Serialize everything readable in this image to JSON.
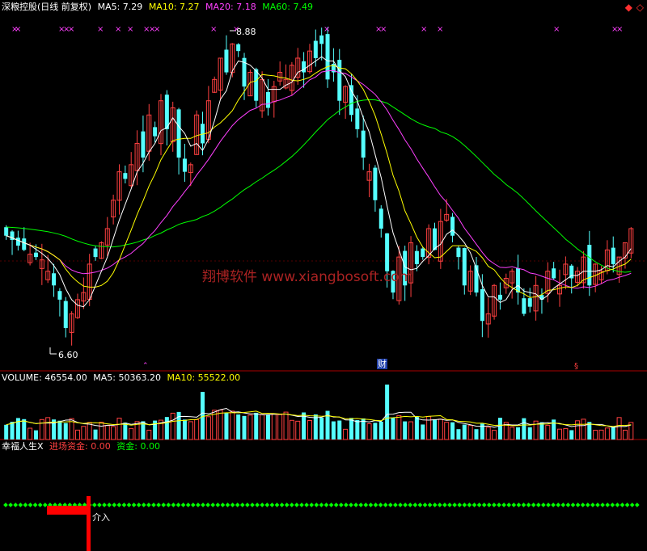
{
  "colors": {
    "up": "#ff4040",
    "down": "#55ffff",
    "ma5": "#ffffff",
    "ma10": "#ffff00",
    "ma20": "#ff40ff",
    "ma60": "#00ff00",
    "volma10": "#ffff00",
    "grid": "#aa0000",
    "marker": "#ff40ff",
    "dot": "#00ff00",
    "signal": "#ff0000"
  },
  "header_price": {
    "stock": "深粮控股(日线 前复权)",
    "ma5": "MA5: 7.29",
    "ma10": "MA10: 7.27",
    "ma20": "MA20: 7.18",
    "ma60": "MA60: 7.49"
  },
  "header_volume": {
    "volume": "VOLUME: 46554.00",
    "ma5": "MA5: 50363.20",
    "ma10": "MA10: 55522.00"
  },
  "header_indicator": {
    "name": "幸福人生X",
    "inflow": "进场资金: 0.00",
    "fund": "资金: 0.00"
  },
  "annotations": {
    "high": "8.88",
    "low": "6.60",
    "cai": "财",
    "signal": "介入",
    "watermark": "翔博软件 www.xiangbosoft.com"
  },
  "chart_data": {
    "type": "candlestick",
    "title": "深粮控股(日线 前复权)",
    "price_range": [
      6.55,
      8.95
    ],
    "high_label": 8.88,
    "low_label": 6.6,
    "closes": [
      7.45,
      7.42,
      7.38,
      7.35,
      7.32,
      7.3,
      7.28,
      7.2,
      7.1,
      7.0,
      6.8,
      6.9,
      7.0,
      7.05,
      7.25,
      7.3,
      7.4,
      7.5,
      7.7,
      7.9,
      7.85,
      7.95,
      8.1,
      8.0,
      8.3,
      8.15,
      8.4,
      8.2,
      8.35,
      8.0,
      7.9,
      7.95,
      8.3,
      8.1,
      8.4,
      8.55,
      8.7,
      8.6,
      8.8,
      8.75,
      8.5,
      8.6,
      8.4,
      8.55,
      8.35,
      8.5,
      8.6,
      8.55,
      8.65,
      8.7,
      8.6,
      8.75,
      8.7,
      8.8,
      8.55,
      8.6,
      8.4,
      8.5,
      8.3,
      8.2,
      8.0,
      7.9,
      7.7,
      7.5,
      7.2,
      7.05,
      7.3,
      7.1,
      7.4,
      7.25,
      7.3,
      7.5,
      7.35,
      7.55,
      7.6,
      7.45,
      7.3,
      7.1,
      7.2,
      7.05,
      6.85,
      6.9,
      7.1,
      7.0,
      7.15,
      7.2,
      7.05,
      6.9,
      6.95,
      7.1,
      7.0,
      7.2,
      7.15,
      7.1,
      7.25,
      7.15,
      7.2,
      7.3,
      7.1,
      7.25,
      7.2,
      7.35,
      7.25,
      7.3,
      7.4,
      7.5
    ],
    "series_colors": {
      "MA5": "#ffffff",
      "MA10": "#ffff00",
      "MA20": "#ff40ff",
      "MA60": "#00ff00"
    },
    "volume_range": [
      0,
      150000
    ]
  }
}
